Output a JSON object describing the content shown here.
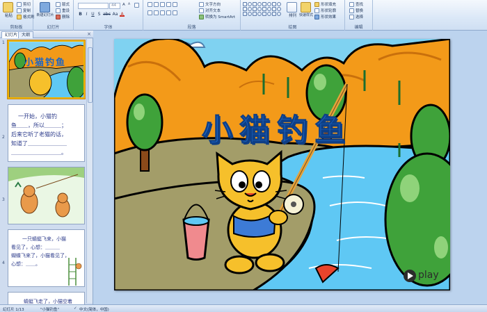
{
  "ribbon": {
    "clipboard": {
      "paste": "粘贴",
      "cut": "剪切",
      "copy": "复制",
      "format_painter": "格式刷",
      "label": "剪贴板"
    },
    "slides": {
      "new_slide": "新建幻灯片",
      "layout": "版式",
      "reset": "重设",
      "delete": "删除",
      "label": "幻灯片"
    },
    "font": {
      "font_name": "",
      "font_size": "44",
      "label": "字体",
      "bold": "B",
      "italic": "I",
      "underline": "U",
      "shadow": "S",
      "strike": "abc",
      "case": "Aa",
      "color": "A"
    },
    "paragraph": {
      "text_direction": "文字方向",
      "align_text": "对齐文本",
      "smartart": "转换为 SmartArt",
      "label": "段落"
    },
    "drawing": {
      "arrange": "排列",
      "quick_styles": "快速样式",
      "shape_fill": "形状填充",
      "shape_outline": "形状轮廓",
      "shape_effects": "形状效果",
      "label": "绘图"
    },
    "editing": {
      "find": "查找",
      "replace": "替换",
      "select": "选择",
      "label": "编辑"
    }
  },
  "leftpane": {
    "tabs": [
      "幻灯片",
      "大纲"
    ],
    "close": "×",
    "thumbs": [
      {
        "num": "1",
        "title": "小猫钓鱼"
      },
      {
        "num": "2",
        "lines": [
          "一开始，小猫钓",
          "鱼＿＿，所以＿＿＿；",
          "后来它听了老猫的话，",
          "知道了＿＿＿＿＿＿＿",
          "＿＿＿＿＿＿＿＿＿。"
        ]
      },
      {
        "num": "3"
      },
      {
        "num": "4",
        "lines": [
          "一只蜻蜓飞来，小猫",
          "看见了，心想：＿＿＿",
          "蝴蝶飞来了，小猫看见了，",
          "心想：＿＿。"
        ]
      },
      {
        "num": "5",
        "lines": [
          "蜻蜓飞走了，小猫空着"
        ]
      }
    ]
  },
  "slide": {
    "title": "小猫钓鱼",
    "play_label": "play"
  },
  "statusbar": {
    "slide_info": "幻灯片 1/13",
    "theme": "\"小猫钓鱼\"",
    "language": "中文(简体，中国)"
  },
  "colors": {
    "ribbon_bg": "#dbe8f7",
    "workspace_bg": "#bcd3ee",
    "title_blue": "#1e66c4",
    "mountain_orange": "#f39a19",
    "river_blue": "#5fc8f4",
    "tree_green": "#3fa23a"
  }
}
